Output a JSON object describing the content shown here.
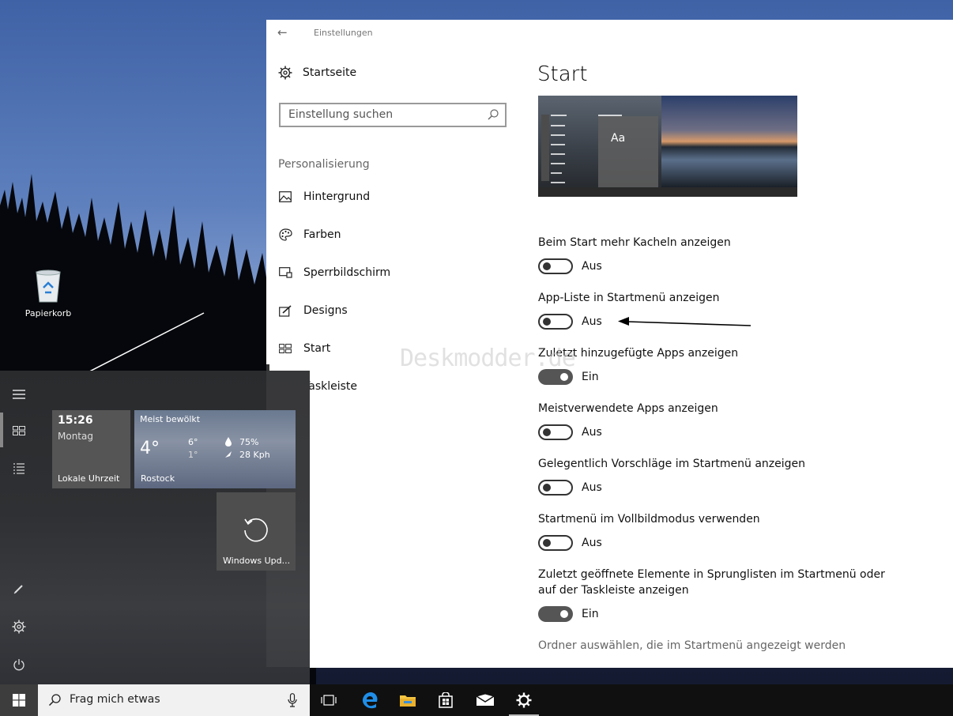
{
  "desktop": {
    "recycle_bin_label": "Papierkorb"
  },
  "settings": {
    "window_title": "Einstellungen",
    "home_label": "Startseite",
    "search_placeholder": "Einstellung suchen",
    "section_label": "Personalisierung",
    "nav_items": [
      {
        "label": "Hintergrund",
        "icon": "picture-icon"
      },
      {
        "label": "Farben",
        "icon": "palette-icon"
      },
      {
        "label": "Sperrbildschirm",
        "icon": "lock-screen-icon"
      },
      {
        "label": "Designs",
        "icon": "designs-icon"
      },
      {
        "label": "Start",
        "icon": "start-icon"
      },
      {
        "label": "Taskleiste",
        "icon": "taskbar-icon"
      }
    ],
    "page_title": "Start",
    "preview_text": "Aa",
    "options": [
      {
        "label": "Beim Start mehr Kacheln anzeigen",
        "state": "Aus",
        "on": false
      },
      {
        "label": "App-Liste in Startmenü anzeigen",
        "state": "Aus",
        "on": false
      },
      {
        "label": "Zuletzt hinzugefügte Apps anzeigen",
        "state": "Ein",
        "on": true
      },
      {
        "label": "Meistverwendete Apps anzeigen",
        "state": "Aus",
        "on": false
      },
      {
        "label": "Gelegentlich Vorschläge im Startmenü anzeigen",
        "state": "Aus",
        "on": false
      },
      {
        "label": "Startmenü im Vollbildmodus verwenden",
        "state": "Aus",
        "on": false
      },
      {
        "label": "Zuletzt geöffnete Elemente in Sprunglisten im Startmenü oder auf der Taskleiste anzeigen",
        "state": "Ein",
        "on": true
      }
    ],
    "folder_link": "Ordner auswählen, die im Startmenü angezeigt werden",
    "watermark": "Deskmodder.de"
  },
  "start_menu": {
    "clock": {
      "time": "15:26",
      "day": "Montag",
      "label": "Lokale Uhrzeit"
    },
    "weather": {
      "condition": "Meist bewölkt",
      "temp": "4°",
      "high": "6°",
      "low": "1°",
      "humidity": "75%",
      "wind": "28 Kph",
      "city": "Rostock"
    },
    "update_tile": "Windows Upd..."
  },
  "taskbar": {
    "search_placeholder": "Frag mich etwas"
  },
  "colors": {
    "toggle_on": "#555555",
    "accent": "#0078d7"
  }
}
